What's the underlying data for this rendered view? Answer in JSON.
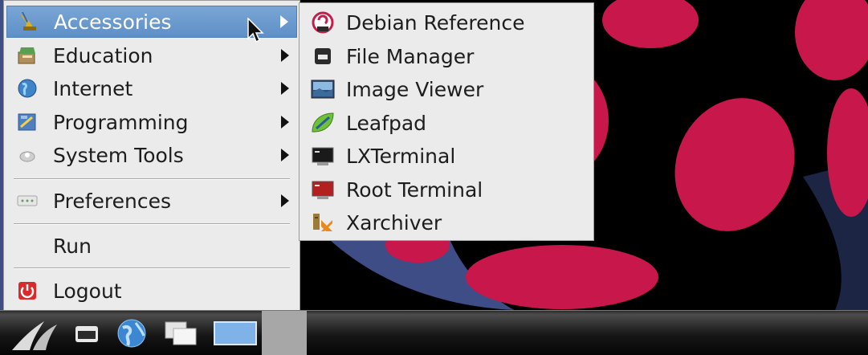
{
  "main_menu": {
    "items": [
      {
        "label": "Accessories",
        "icon": "accessories-icon",
        "has_submenu": true,
        "active": true
      },
      {
        "label": "Education",
        "icon": "education-icon",
        "has_submenu": true
      },
      {
        "label": "Internet",
        "icon": "internet-globe-icon",
        "has_submenu": true
      },
      {
        "label": "Programming",
        "icon": "programming-icon",
        "has_submenu": true
      },
      {
        "label": "System Tools",
        "icon": "system-tools-icon",
        "has_submenu": true
      },
      {
        "label": "Preferences",
        "icon": "preferences-icon",
        "has_submenu": true
      },
      {
        "label": "Run",
        "icon": "",
        "has_submenu": false
      },
      {
        "label": "Logout",
        "icon": "logout-power-icon",
        "has_submenu": false
      }
    ]
  },
  "submenu": {
    "items": [
      {
        "label": "Debian Reference",
        "icon": "debian-reference-icon"
      },
      {
        "label": "File Manager",
        "icon": "file-manager-icon"
      },
      {
        "label": "Image Viewer",
        "icon": "image-viewer-icon"
      },
      {
        "label": "Leafpad",
        "icon": "leafpad-icon"
      },
      {
        "label": "LXTerminal",
        "icon": "terminal-icon"
      },
      {
        "label": "Root Terminal",
        "icon": "root-terminal-icon"
      },
      {
        "label": "Xarchiver",
        "icon": "xarchiver-icon"
      }
    ]
  },
  "taskbar": {
    "buttons": [
      "menu-launcher-icon",
      "file-manager-icon",
      "web-browser-globe-icon",
      "window-switcher-icon",
      "desktop-icon"
    ]
  },
  "colors": {
    "wallpaper_bg": "#3f4d86",
    "raspberry_red": "#c8174a",
    "menu_bg": "#ebebeb",
    "highlight": "#6a99cc"
  }
}
